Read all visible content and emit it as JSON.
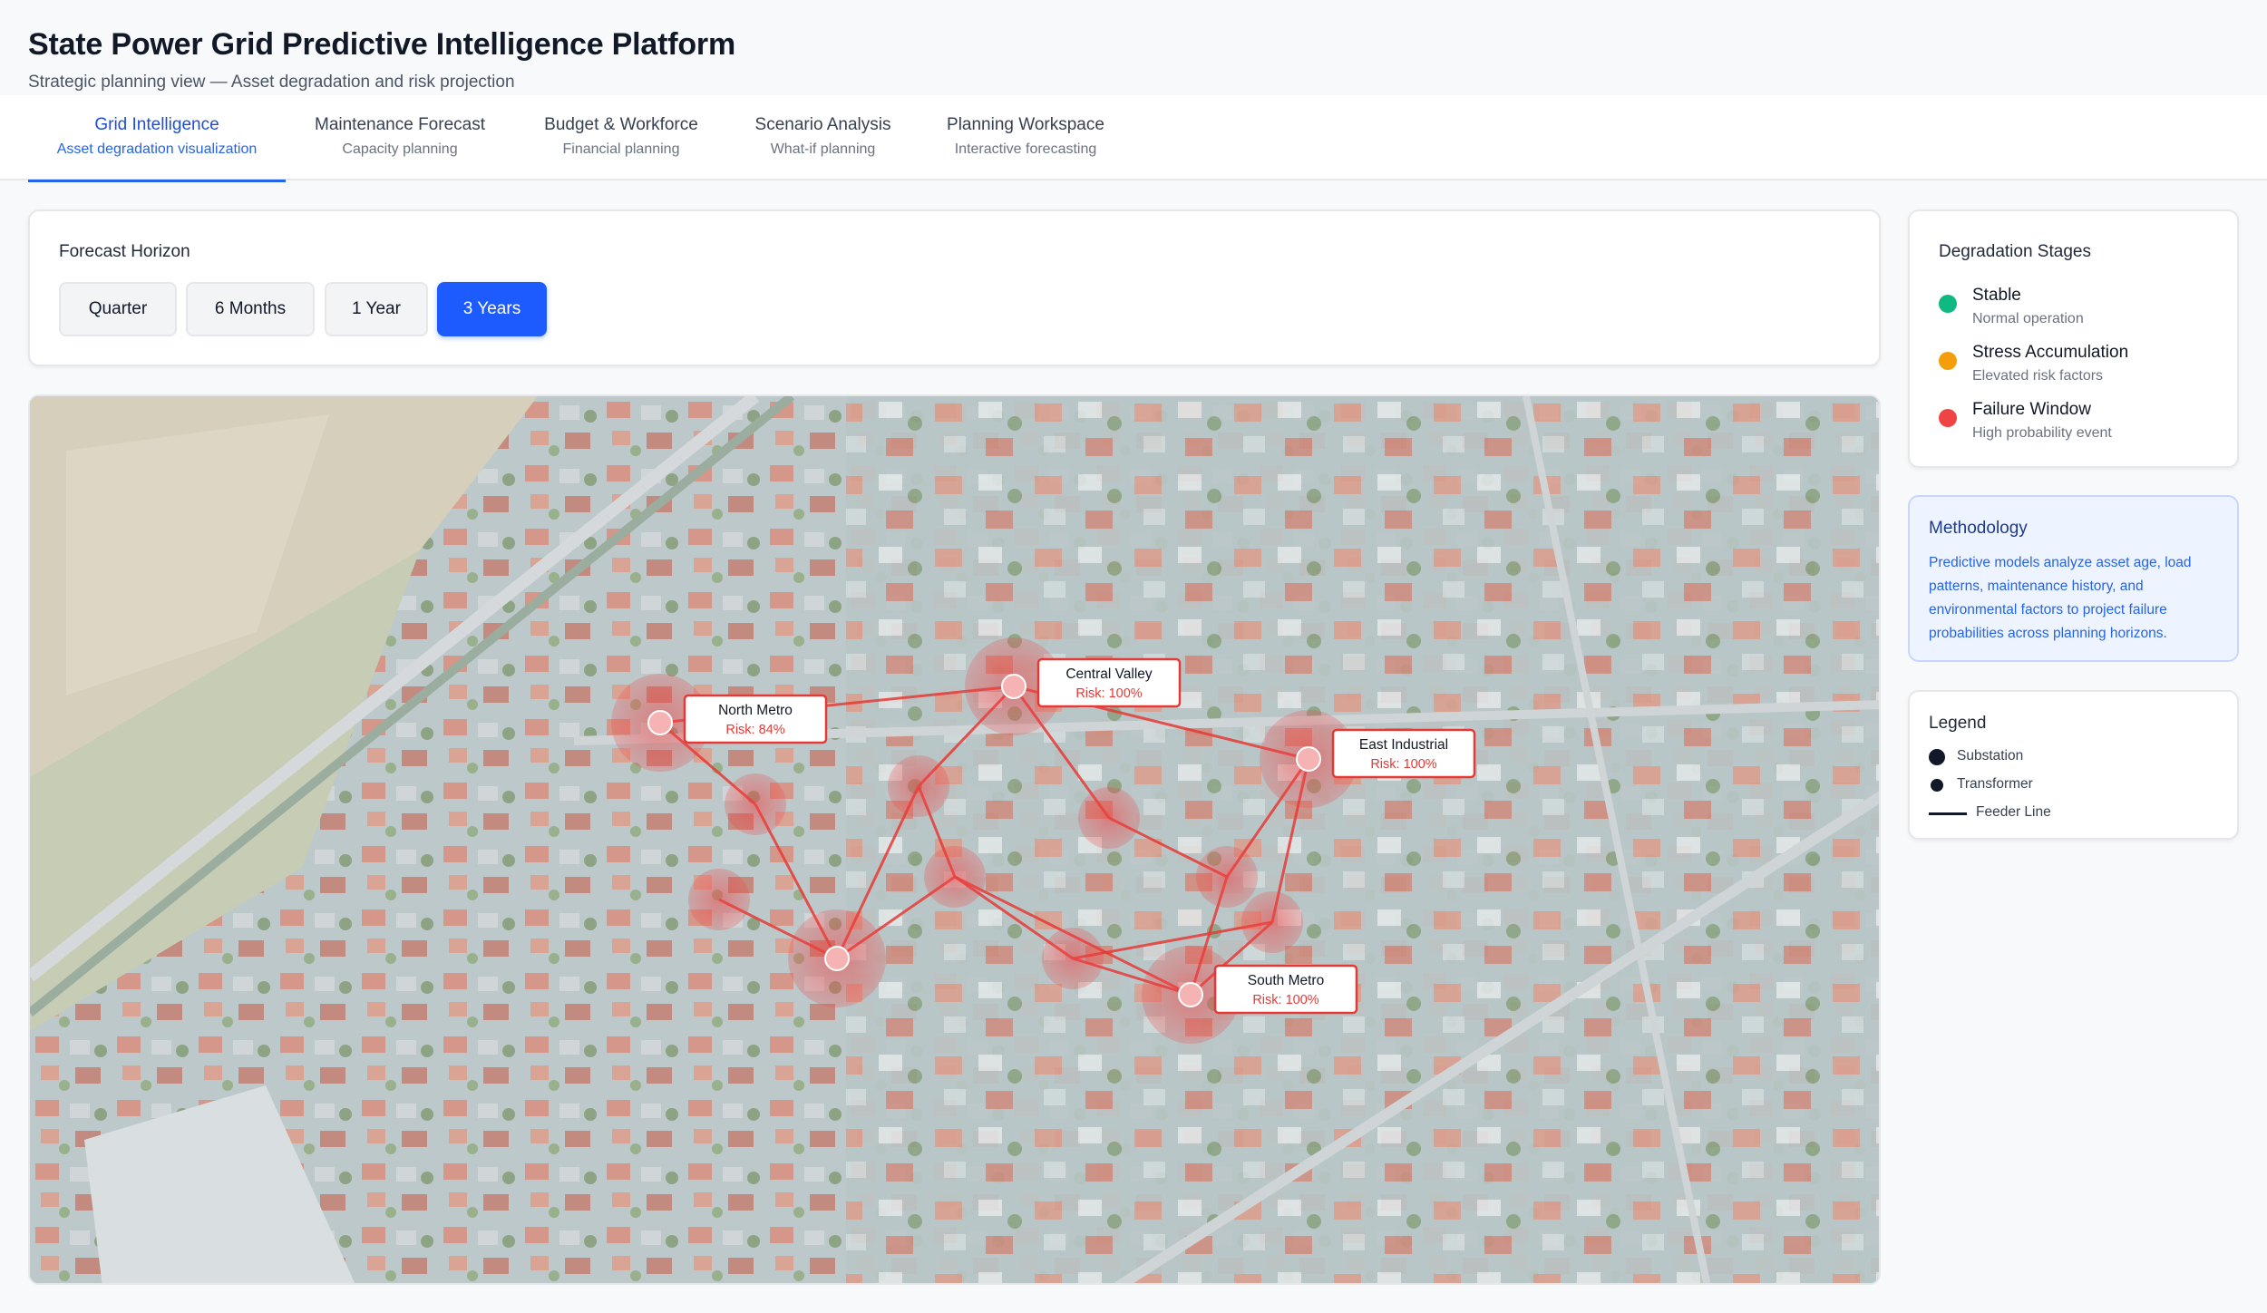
{
  "header": {
    "title": "State Power Grid Predictive Intelligence Platform",
    "subtitle": "Strategic planning view — Asset degradation and risk projection"
  },
  "tabs": [
    {
      "label": "Grid Intelligence",
      "sub": "Asset degradation visualization",
      "active": true
    },
    {
      "label": "Maintenance Forecast",
      "sub": "Capacity planning"
    },
    {
      "label": "Budget & Workforce",
      "sub": "Financial planning"
    },
    {
      "label": "Scenario Analysis",
      "sub": "What-if planning"
    },
    {
      "label": "Planning Workspace",
      "sub": "Interactive forecasting"
    }
  ],
  "horizon": {
    "label": "Forecast Horizon",
    "options": [
      "Quarter",
      "6 Months",
      "1 Year",
      "3 Years"
    ],
    "selected": "3 Years"
  },
  "map": {
    "substations": [
      {
        "name": "North Metro",
        "risk": "Risk: 84%"
      },
      {
        "name": "Central Valley",
        "risk": "Risk: 100%"
      },
      {
        "name": "East Industrial",
        "risk": "Risk: 100%"
      },
      {
        "name": "South Metro",
        "risk": "Risk: 100%"
      }
    ]
  },
  "stages": {
    "title": "Degradation Stages",
    "items": [
      {
        "name": "Stable",
        "desc": "Normal operation",
        "color": "#10b981"
      },
      {
        "name": "Stress Accumulation",
        "desc": "Elevated risk factors",
        "color": "#f59e0b"
      },
      {
        "name": "Failure Window",
        "desc": "High probability event",
        "color": "#ef4444"
      }
    ]
  },
  "methodology": {
    "title": "Methodology",
    "text": "Predictive models analyze asset age, load patterns, maintenance history, and environmental factors to project failure probabilities across planning horizons."
  },
  "legend": {
    "title": "Legend",
    "substation": "Substation",
    "transformer": "Transformer",
    "feeder": "Feeder Line"
  },
  "colors": {
    "accent": "#1d5bff",
    "risk": "#ef4444"
  }
}
